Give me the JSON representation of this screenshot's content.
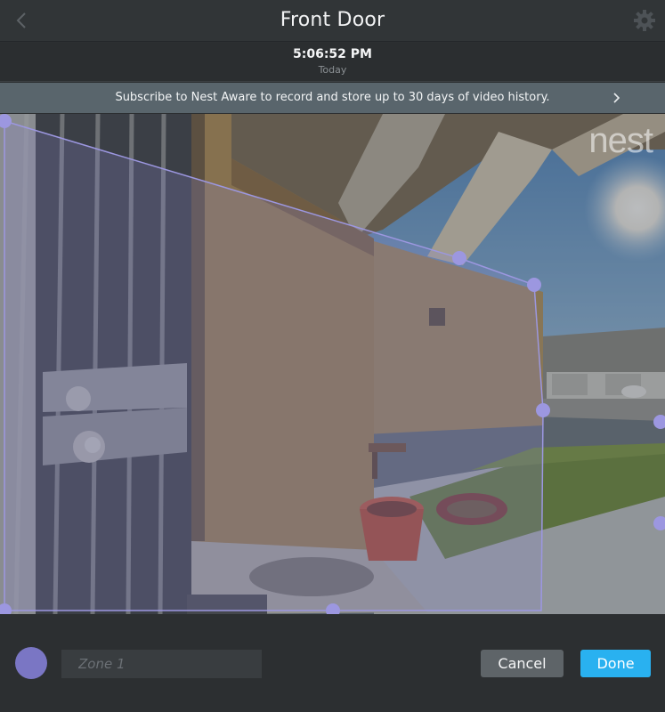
{
  "header": {
    "title": "Front Door",
    "back_icon": "chevron-left-icon",
    "settings_icon": "gear-icon"
  },
  "timeline": {
    "time": "5:06:52 PM",
    "date": "Today"
  },
  "banner": {
    "text": "Subscribe to Nest Aware to record and store up to 30 days of video history.",
    "icon": "chevron-right-icon"
  },
  "video": {
    "watermark": "nest",
    "zone_color": "#8f8ad6"
  },
  "footer": {
    "zone_name_placeholder": "Zone 1",
    "zone_name_value": "",
    "zone_color": "#7a76c4",
    "cancel_label": "Cancel",
    "done_label": "Done"
  },
  "colors": {
    "accent": "#29b1f0",
    "header_bg": "#313537",
    "banner_bg": "#59656c"
  }
}
